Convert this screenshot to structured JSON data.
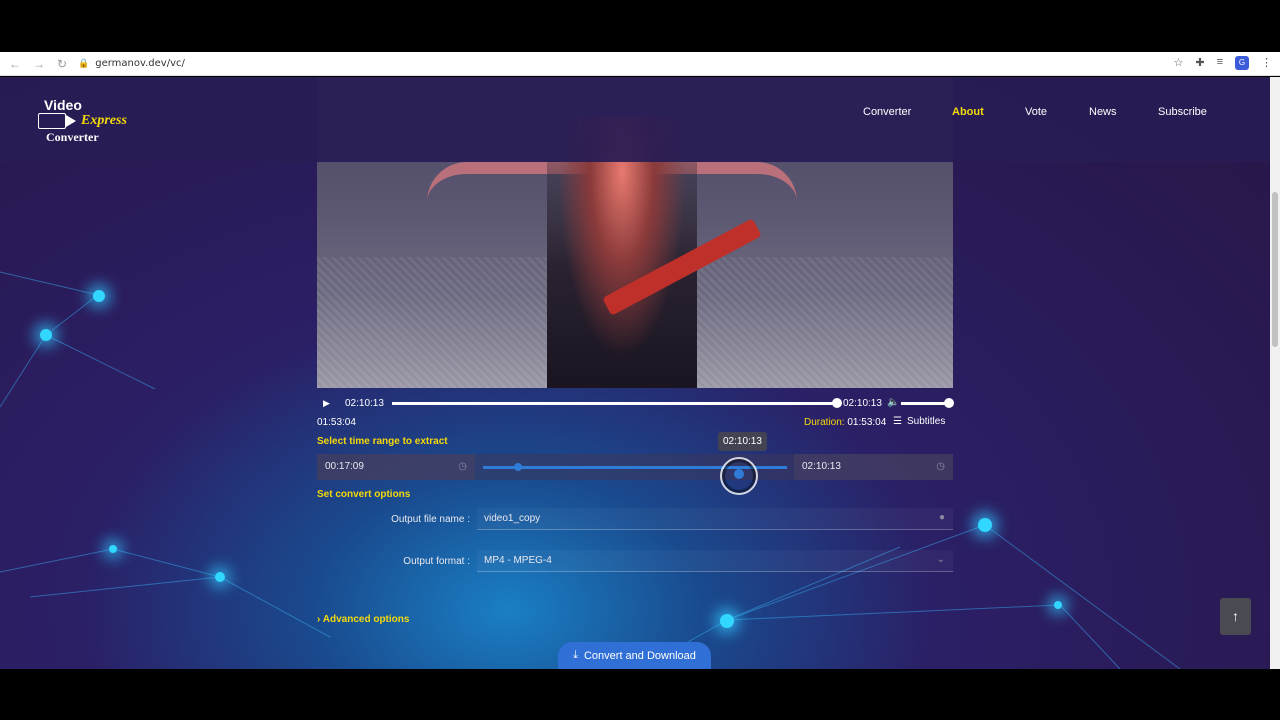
{
  "browser": {
    "url": "germanov.dev/vc/",
    "nav_icons": [
      "back-icon",
      "forward-icon",
      "reload-icon"
    ],
    "right_icons": [
      "star-icon",
      "puzzle-icon",
      "playlist-icon",
      "profile-icon",
      "more-icon"
    ]
  },
  "header": {
    "logo": {
      "line1": "Video",
      "line2": "Express",
      "line3": "Converter"
    },
    "menu": [
      {
        "label": "Converter",
        "active": false
      },
      {
        "label": "About",
        "active": true
      },
      {
        "label": "Vote",
        "active": false
      },
      {
        "label": "News",
        "active": false
      },
      {
        "label": "Subscribe",
        "active": false
      }
    ]
  },
  "player": {
    "current_time": "02:10:13",
    "end_time": "02:10:13",
    "position_time": "01:53:04",
    "duration_label": "Duration:",
    "duration_value": "01:53:04",
    "subtitles_label": "Subtitles",
    "progress": 0.99,
    "volume": 1.0
  },
  "range": {
    "title": "Select time range to extract",
    "start": "00:17:09",
    "end": "02:10:13",
    "tooltip": "02:10:13"
  },
  "convert": {
    "title": "Set convert options",
    "filename_label": "Output file name :",
    "filename_value": "video1_copy",
    "format_label": "Output format :",
    "format_value": "MP4 - MPEG-4",
    "advanced_label": "Advanced options",
    "button_label": "Convert and Download"
  },
  "colors": {
    "accent": "#f5d90a",
    "primary": "#2f6fd6",
    "background": "#2a1a55"
  }
}
